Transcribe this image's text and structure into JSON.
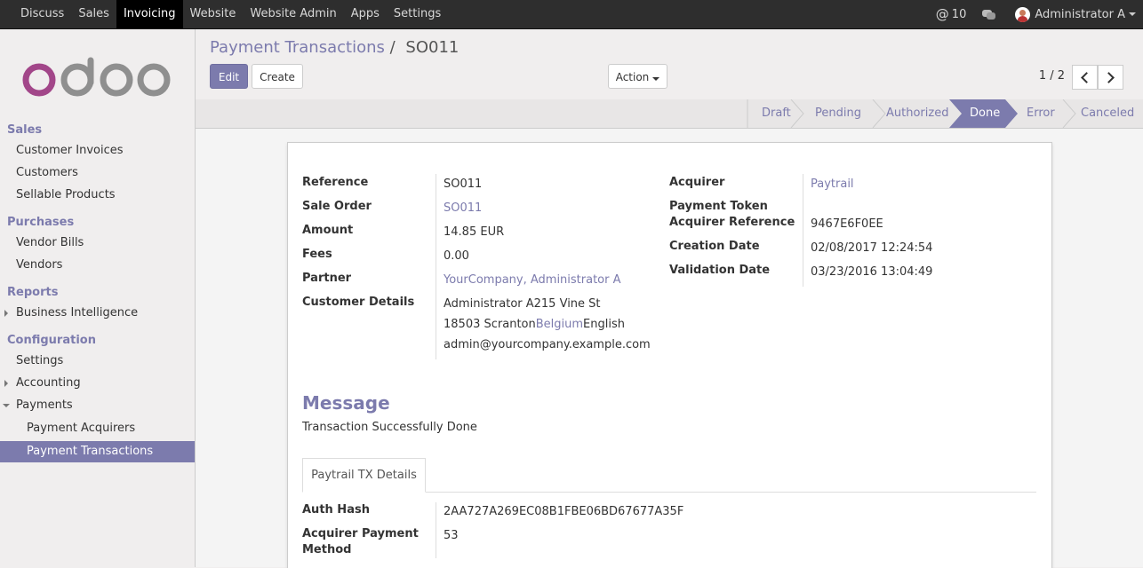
{
  "topbar": {
    "menu": [
      "Discuss",
      "Sales",
      "Invoicing",
      "Website",
      "Website Admin",
      "Apps",
      "Settings"
    ],
    "active": "Invoicing",
    "mentions_count": "10",
    "user": "Administrator A"
  },
  "sidebar": {
    "logo_text": "odoo",
    "sections": {
      "sales": "Sales",
      "purchases": "Purchases",
      "reports": "Reports",
      "configuration": "Configuration"
    },
    "items": {
      "customer_invoices": "Customer Invoices",
      "customers": "Customers",
      "sellable_products": "Sellable Products",
      "vendor_bills": "Vendor Bills",
      "vendors": "Vendors",
      "business_intelligence": "Business Intelligence",
      "settings": "Settings",
      "accounting": "Accounting",
      "payments": "Payments",
      "payment_acquirers": "Payment Acquirers",
      "payment_transactions": "Payment Transactions"
    }
  },
  "control_panel": {
    "breadcrumb_parent": "Payment Transactions",
    "breadcrumb_sep": "/",
    "breadcrumb_current": "SO011",
    "edit_label": "Edit",
    "create_label": "Create",
    "action_label": "Action",
    "pager": "1 / 2"
  },
  "status": {
    "stages": [
      "Draft",
      "Pending",
      "Authorized",
      "Done",
      "Error",
      "Canceled"
    ],
    "current": "Done"
  },
  "form": {
    "left": {
      "reference_label": "Reference",
      "reference": "SO011",
      "sale_order_label": "Sale Order",
      "sale_order": "SO011",
      "amount_label": "Amount",
      "amount": "14.85",
      "currency": "EUR",
      "fees_label": "Fees",
      "fees": "0.00",
      "partner_label": "Partner",
      "partner": "YourCompany, Administrator A",
      "customer_details_label": "Customer Details",
      "cd_line1": "Administrator A215 Vine St",
      "cd_zip": "18503",
      "cd_city": "Scranton",
      "cd_country": "Belgium",
      "cd_lang": "English",
      "cd_email": "admin@yourcompany.example.com"
    },
    "right": {
      "acquirer_label": "Acquirer",
      "acquirer": "Paytrail",
      "payment_token_label": "Payment Token",
      "acquirer_reference_label": "Acquirer Reference",
      "acquirer_reference": "9467E6F0EE",
      "creation_date_label": "Creation Date",
      "creation_date": "02/08/2017 12:24:54",
      "validation_date_label": "Validation Date",
      "validation_date": "03/23/2016 13:04:49"
    },
    "message_title": "Message",
    "message": "Transaction Successfully Done",
    "tab_label": "Paytrail TX Details",
    "auth_hash_label": "Auth Hash",
    "auth_hash": "2AA727A269EC08B1FBE06BD67677A35F",
    "acquirer_payment_method_label_1": "Acquirer Payment",
    "acquirer_payment_method_label_2": "Method",
    "acquirer_payment_method": "53"
  },
  "colors": {
    "accent": "#7c7bad",
    "topbar": "#2e2e2e"
  }
}
